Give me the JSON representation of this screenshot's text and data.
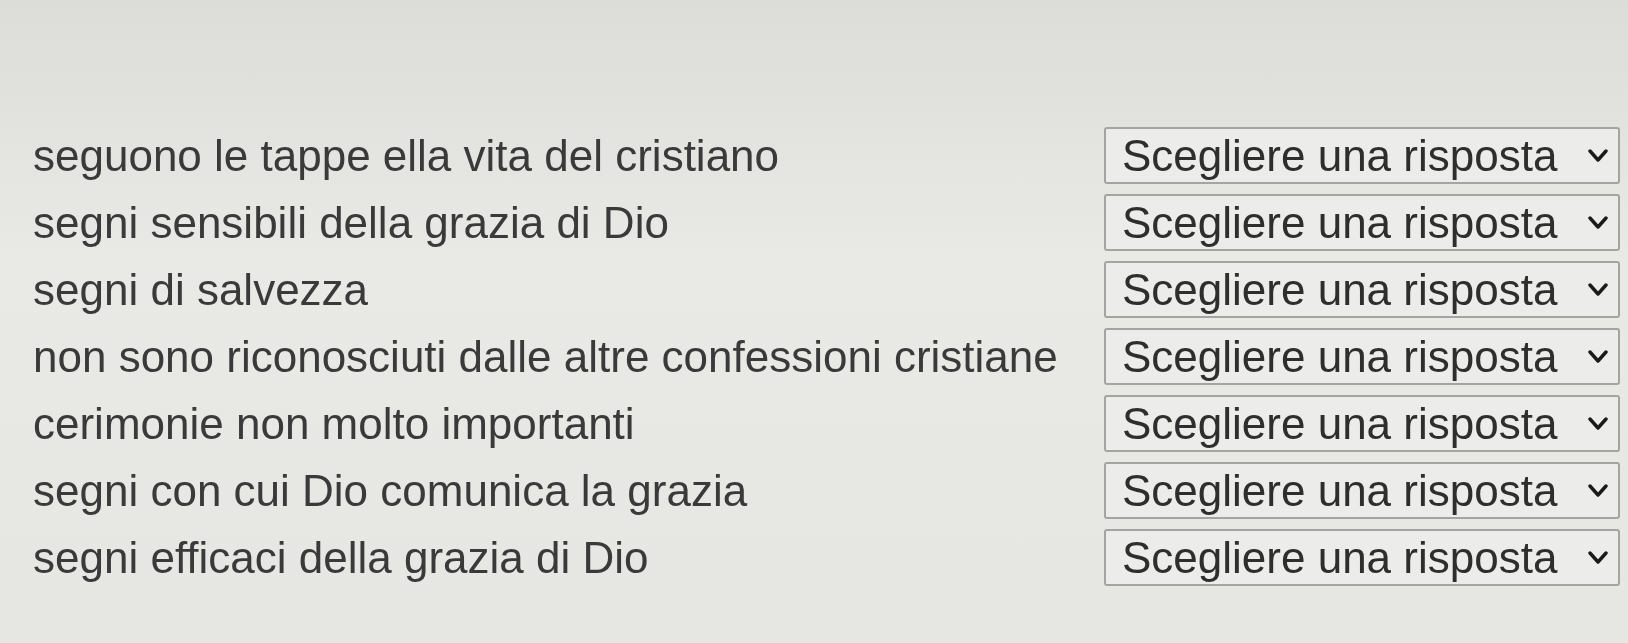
{
  "rows": [
    {
      "prompt": "seguono le tappe ella vita del cristiano",
      "answer": "Scegliere una risposta"
    },
    {
      "prompt": "segni sensibili della grazia di Dio",
      "answer": "Scegliere una risposta"
    },
    {
      "prompt": "segni di salvezza",
      "answer": "Scegliere una risposta"
    },
    {
      "prompt": "non sono riconosciuti dalle altre confessioni cristiane",
      "answer": "Scegliere una risposta"
    },
    {
      "prompt": "cerimonie non molto importanti",
      "answer": "Scegliere una risposta"
    },
    {
      "prompt": "segni con cui Dio comunica la grazia",
      "answer": "Scegliere una risposta"
    },
    {
      "prompt": "segni efficaci della grazia di Dio",
      "answer": "Scegliere una risposta"
    }
  ]
}
